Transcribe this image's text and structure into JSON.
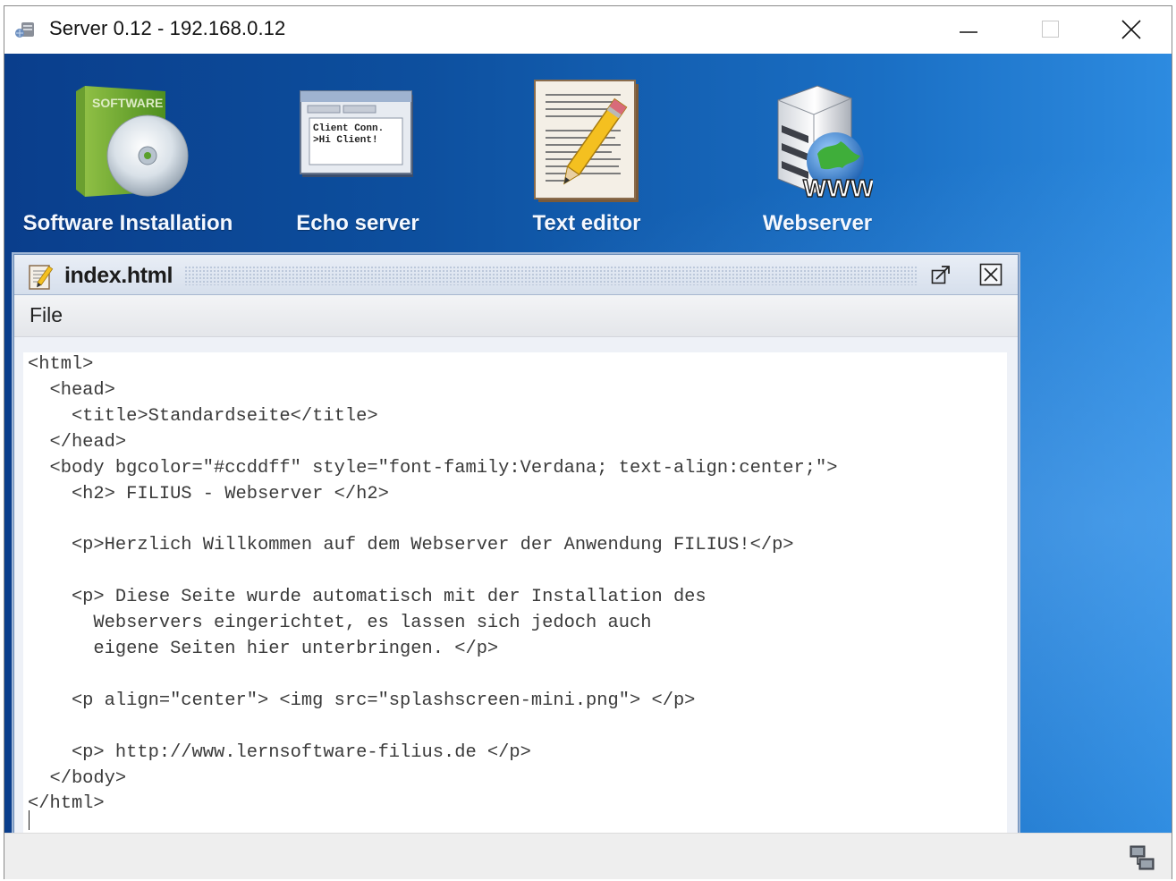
{
  "window": {
    "title": "Server 0.12 - 192.168.0.12",
    "app_icon": "server-icon",
    "controls": [
      "minimize-icon",
      "maximize-icon",
      "close-icon"
    ]
  },
  "desktop": {
    "apps": [
      {
        "label": "Software Installation",
        "icon": "software-box-cd-icon"
      },
      {
        "label": "Echo server",
        "icon": "terminal-window-icon",
        "icon_text_line1": "Client Conn.",
        "icon_text_line2": ">Hi Client!"
      },
      {
        "label": "Text editor",
        "icon": "document-pencil-icon"
      },
      {
        "label": "Webserver",
        "icon": "server-globe-www-icon",
        "icon_text": "WWW"
      }
    ]
  },
  "editor_window": {
    "title": "index.html",
    "icon": "document-edit-icon",
    "buttons": [
      "popout-icon",
      "close-icon"
    ],
    "menu": {
      "file": "File"
    },
    "content": "<html>\n  <head>\n    <title>Standardseite</title>\n  </head>\n  <body bgcolor=\"#ccddff\" style=\"font-family:Verdana; text-align:center;\">\n    <h2> FILIUS - Webserver </h2>\n\n    <p>Herzlich Willkommen auf dem Webserver der Anwendung FILIUS!</p>\n\n    <p> Diese Seite wurde automatisch mit der Installation des\n      Webservers eingerichtet, es lassen sich jedoch auch\n      eigene Seiten hier unterbringen. </p>\n\n    <p align=\"center\"> <img src=\"splashscreen-mini.png\"> </p>\n\n    <p> http://www.lernsoftware-filius.de </p>\n  </body>\n</html>"
  },
  "statusbar": {
    "icon": "network-computers-icon"
  },
  "colors": {
    "desktop_dark": "#0a3e8c",
    "desktop_light": "#2d8be0",
    "frame_border": "#6c8db8",
    "app_label": "#f4f8ff"
  }
}
